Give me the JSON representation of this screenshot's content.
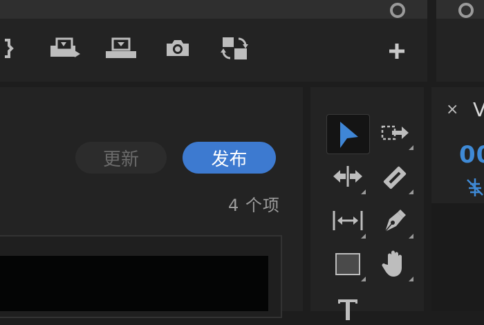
{
  "program_monitor": {
    "toolbar": [
      {
        "name": "insert-icon"
      },
      {
        "name": "export-frame-clip-icon"
      },
      {
        "name": "lift-to-monitor-icon"
      },
      {
        "name": "camera-icon"
      },
      {
        "name": "swap-icon"
      },
      {
        "name": "add-icon"
      }
    ]
  },
  "project": {
    "update_label": "更新",
    "publish_label": "发布",
    "item_count": "4 个项"
  },
  "tools": [
    {
      "name": "selection-tool-icon",
      "active": true
    },
    {
      "name": "track-select-forward-icon"
    },
    {
      "name": "ripple-edit-tool-icon"
    },
    {
      "name": "razor-tool-icon"
    },
    {
      "name": "slip-tool-icon"
    },
    {
      "name": "pen-tool-icon"
    },
    {
      "name": "rectangle-tool-icon"
    },
    {
      "name": "hand-tool-icon"
    },
    {
      "name": "type-tool-icon"
    }
  ],
  "timeline": {
    "close_symbol": "×",
    "tab_label": "V",
    "timecode": "00"
  },
  "colors": {
    "accent": "#3d7ad0",
    "timecode": "#3f8ad6",
    "panel": "#232323",
    "background": "#1d1d1d"
  }
}
